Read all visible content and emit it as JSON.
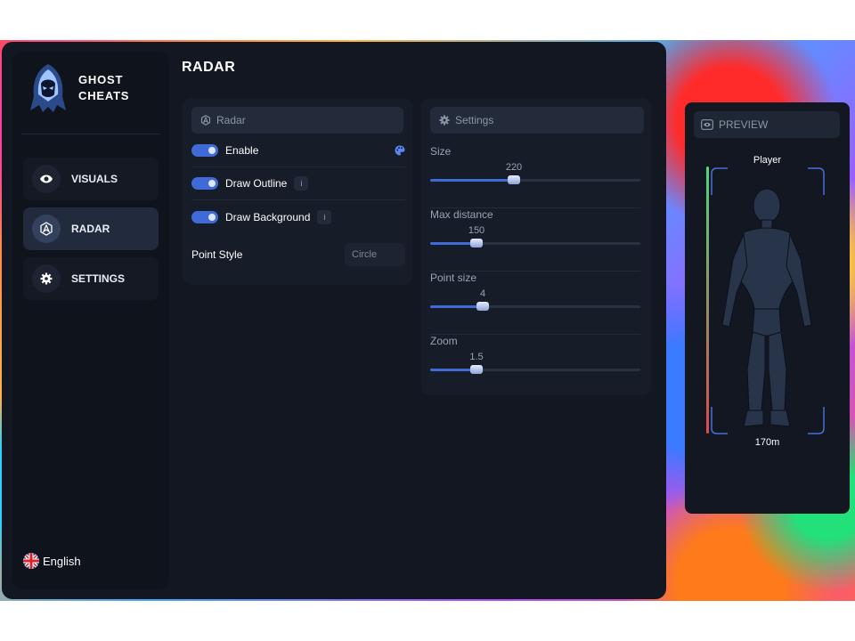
{
  "brand": {
    "line1": "GHOST",
    "line2": "CHEATS"
  },
  "sidebar": {
    "items": [
      {
        "label": "VISUALS",
        "icon": "eye-icon",
        "active": false
      },
      {
        "label": "RADAR",
        "icon": "radar-icon",
        "active": true
      },
      {
        "label": "SETTINGS",
        "icon": "gear-icon",
        "active": false
      }
    ],
    "language": "English"
  },
  "page": {
    "title": "RADAR"
  },
  "radar_panel": {
    "header": "Radar",
    "toggles": [
      {
        "label": "Enable",
        "on": true,
        "extra": "palette-icon"
      },
      {
        "label": "Draw Outline",
        "on": true,
        "extra": "info-icon"
      },
      {
        "label": "Draw Background",
        "on": true,
        "extra": "info-icon"
      }
    ],
    "info_glyph": "i",
    "point_style": {
      "label": "Point Style",
      "value": "Circle"
    }
  },
  "settings_panel": {
    "header": "Settings",
    "sliders": [
      {
        "label": "Size",
        "value": "220",
        "fraction": 0.4
      },
      {
        "label": "Max distance",
        "value": "150",
        "fraction": 0.22
      },
      {
        "label": "Point size",
        "value": "4",
        "fraction": 0.25
      },
      {
        "label": "Zoom",
        "value": "1.5",
        "fraction": 0.22
      }
    ]
  },
  "preview": {
    "header": "PREVIEW",
    "player_name": "Player",
    "distance": "170m"
  },
  "colors": {
    "accent": "#3f6ad8",
    "panel": "#161c28",
    "window": "#121722",
    "health_top": "#4cd97b",
    "health_bottom": "#d94c4c"
  }
}
